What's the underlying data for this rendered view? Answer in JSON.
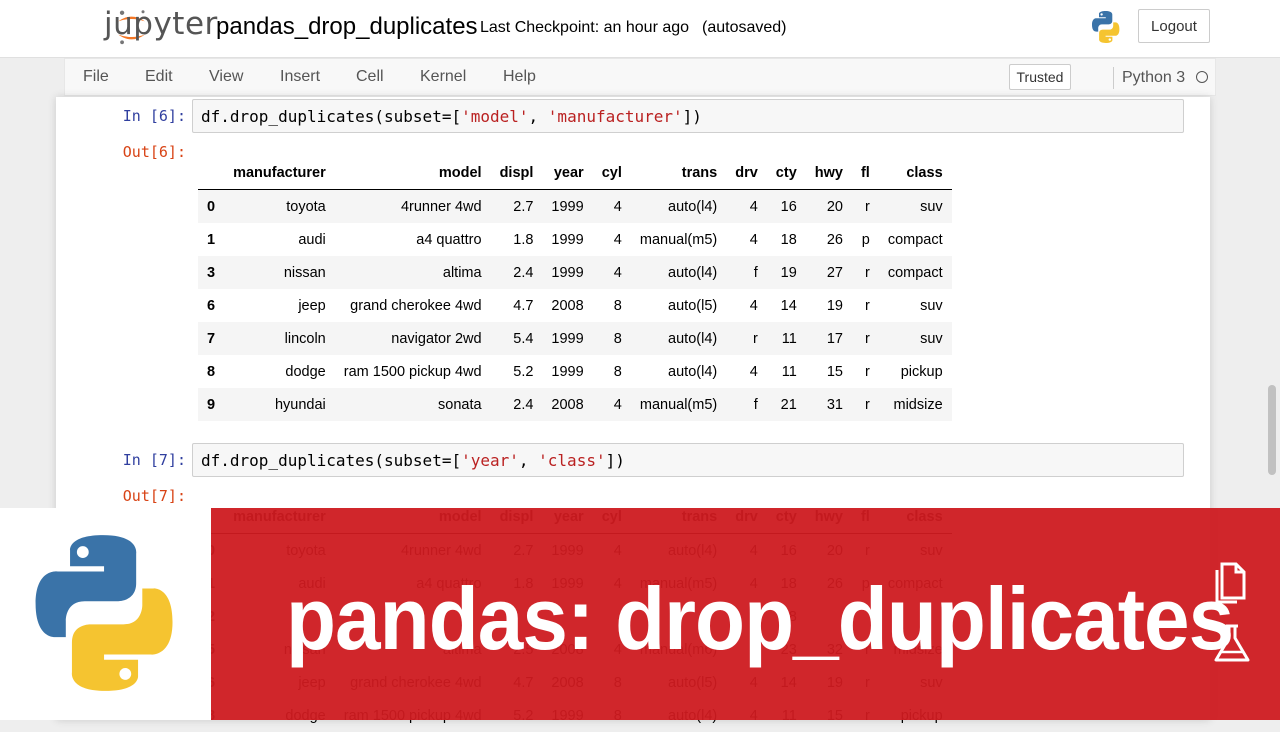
{
  "header": {
    "logo_text": "jupyter",
    "notebook_name": "pandas_drop_duplicates",
    "checkpoint": "Last Checkpoint: an hour ago",
    "autosaved": "(autosaved)",
    "logout_label": "Logout"
  },
  "menubar": {
    "items": [
      "File",
      "Edit",
      "View",
      "Insert",
      "Cell",
      "Kernel",
      "Help"
    ],
    "trusted_label": "Trusted",
    "kernel_name": "Python 3"
  },
  "cells": [
    {
      "in_prompt": "In [6]:",
      "code_prefix": "df.drop_duplicates(subset=[",
      "code_str1": "'model'",
      "code_sep": ", ",
      "code_str2": "'manufacturer'",
      "code_suffix": "])",
      "out_prompt": "Out[6]:",
      "columns": [
        "",
        "manufacturer",
        "model",
        "displ",
        "year",
        "cyl",
        "trans",
        "drv",
        "cty",
        "hwy",
        "fl",
        "class"
      ],
      "rows": [
        [
          "0",
          "toyota",
          "4runner 4wd",
          "2.7",
          "1999",
          "4",
          "auto(l4)",
          "4",
          "16",
          "20",
          "r",
          "suv"
        ],
        [
          "1",
          "audi",
          "a4 quattro",
          "1.8",
          "1999",
          "4",
          "manual(m5)",
          "4",
          "18",
          "26",
          "p",
          "compact"
        ],
        [
          "3",
          "nissan",
          "altima",
          "2.4",
          "1999",
          "4",
          "auto(l4)",
          "f",
          "19",
          "27",
          "r",
          "compact"
        ],
        [
          "6",
          "jeep",
          "grand cherokee 4wd",
          "4.7",
          "2008",
          "8",
          "auto(l5)",
          "4",
          "14",
          "19",
          "r",
          "suv"
        ],
        [
          "7",
          "lincoln",
          "navigator 2wd",
          "5.4",
          "1999",
          "8",
          "auto(l4)",
          "r",
          "11",
          "17",
          "r",
          "suv"
        ],
        [
          "8",
          "dodge",
          "ram 1500 pickup 4wd",
          "5.2",
          "1999",
          "8",
          "auto(l4)",
          "4",
          "11",
          "15",
          "r",
          "pickup"
        ],
        [
          "9",
          "hyundai",
          "sonata",
          "2.4",
          "2008",
          "4",
          "manual(m5)",
          "f",
          "21",
          "31",
          "r",
          "midsize"
        ]
      ]
    },
    {
      "in_prompt": "In [7]:",
      "code_prefix": "df.drop_duplicates(subset=[",
      "code_str1": "'year'",
      "code_sep": ", ",
      "code_str2": "'class'",
      "code_suffix": "])",
      "out_prompt": "Out[7]:",
      "columns": [
        "",
        "manufacturer",
        "model",
        "displ",
        "year",
        "cyl",
        "trans",
        "drv",
        "cty",
        "hwy",
        "fl",
        "class"
      ],
      "rows": [
        [
          "0",
          "toyota",
          "4runner 4wd",
          "2.7",
          "1999",
          "4",
          "auto(l4)",
          "4",
          "16",
          "20",
          "r",
          "suv"
        ],
        [
          "1",
          "audi",
          "a4 quattro",
          "1.8",
          "1999",
          "4",
          "manual(m5)",
          "4",
          "18",
          "26",
          "p",
          "compact"
        ],
        [
          "2",
          "",
          "",
          "",
          "",
          "",
          "",
          "",
          "18",
          "",
          "",
          ""
        ],
        [
          "5",
          "nissan",
          "altima",
          "2.5",
          "2008",
          "4",
          "manual(m6)",
          "f",
          "23",
          "32",
          "r",
          "midsize"
        ],
        [
          "6",
          "jeep",
          "grand cherokee 4wd",
          "4.7",
          "2008",
          "8",
          "auto(l5)",
          "4",
          "14",
          "19",
          "r",
          "suv"
        ],
        [
          "8",
          "dodge",
          "ram 1500 pickup 4wd",
          "5.2",
          "1999",
          "8",
          "auto(l4)",
          "4",
          "11",
          "15",
          "r",
          "pickup"
        ]
      ]
    }
  ],
  "banner": {
    "title": "pandas: drop_duplicates",
    "bg_color": "#ce1a20"
  },
  "icons": {
    "python_logo": "python-logo-icon",
    "docs": "documents-icon",
    "flask": "flask-icon",
    "kernel_idle": "kernel-idle-indicator"
  }
}
